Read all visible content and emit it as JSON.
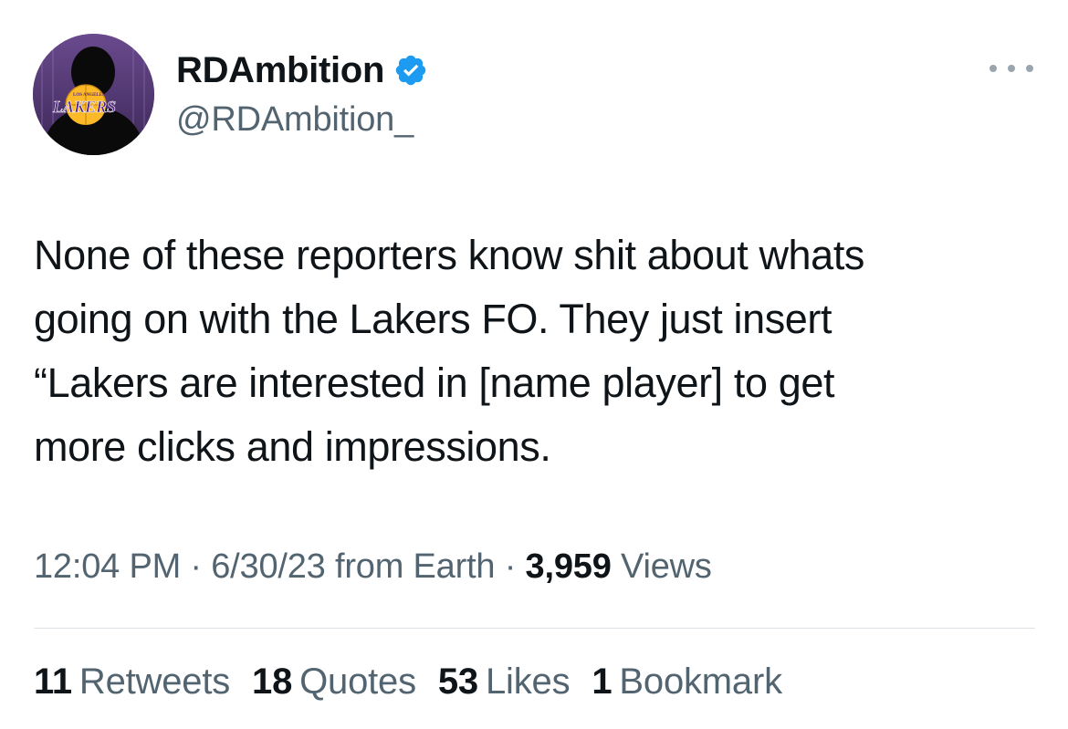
{
  "author": {
    "display_name": "RDAmbition",
    "handle": "@RDAmbition_",
    "verified": true,
    "avatar_icon": "lakers-logo-avatar",
    "avatar_logo_text": "LAKERS",
    "avatar_logo_subtext": "LOS ANGELES"
  },
  "tweet": {
    "text": "None of these reporters know shit about whats\ngoing on with the Lakers FO. They just insert\n“Lakers are interested in [name player] to get\nmore clicks and impressions."
  },
  "meta": {
    "time": "12:04 PM",
    "sep1": " · ",
    "date": "6/30/23",
    "source": " from Earth",
    "sep2": " · ",
    "views_count": "3,959",
    "views_label": " Views"
  },
  "stats": {
    "retweets_count": "11",
    "retweets_label": "Retweets",
    "quotes_count": "18",
    "quotes_label": "Quotes",
    "likes_count": "53",
    "likes_label": "Likes",
    "bookmarks_count": "1",
    "bookmarks_label": "Bookmark"
  },
  "colors": {
    "text_primary": "#0f1419",
    "text_secondary": "#536471",
    "verified_blue": "#1d9bf0",
    "lakers_purple": "#552583",
    "lakers_gold": "#fdb927"
  }
}
